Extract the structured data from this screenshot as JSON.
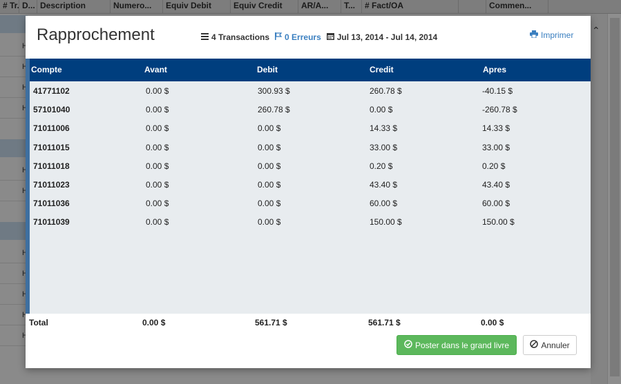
{
  "background": {
    "columns": [
      "# Tr...",
      "D...",
      "Description",
      "Numero...",
      "Equiv Debit",
      "Equiv Credit",
      "AR/A...",
      "T...",
      "# Fact/OA",
      "",
      "Commen..."
    ],
    "row_marker": "H"
  },
  "modal": {
    "title": "Rapprochement",
    "transactions": "4 Transactions",
    "errors": "0 Erreurs",
    "date_range": "Jul 13, 2014 - Jul 14, 2014",
    "print_label": "Imprimer"
  },
  "table": {
    "headers": [
      "Compte",
      "Avant",
      "Debit",
      "Credit",
      "Apres"
    ],
    "rows": [
      [
        "41771102",
        "0.00 $",
        "300.93 $",
        "260.78 $",
        "-40.15 $"
      ],
      [
        "57101040",
        "0.00 $",
        "260.78 $",
        "0.00 $",
        "-260.78 $"
      ],
      [
        "71011006",
        "0.00 $",
        "0.00 $",
        "14.33 $",
        "14.33 $"
      ],
      [
        "71011015",
        "0.00 $",
        "0.00 $",
        "33.00 $",
        "33.00 $"
      ],
      [
        "71011018",
        "0.00 $",
        "0.00 $",
        "0.20 $",
        "0.20 $"
      ],
      [
        "71011023",
        "0.00 $",
        "0.00 $",
        "43.40 $",
        "43.40 $"
      ],
      [
        "71011036",
        "0.00 $",
        "0.00 $",
        "60.00 $",
        "60.00 $"
      ],
      [
        "71011039",
        "0.00 $",
        "0.00 $",
        "150.00 $",
        "150.00 $"
      ]
    ],
    "total": [
      "Total",
      "0.00 $",
      "561.71 $",
      "561.71 $",
      "0.00 $"
    ]
  },
  "buttons": {
    "post": "Poster dans le grand livre",
    "cancel": "Annuler"
  },
  "colors": {
    "header_bg": "#003e7e",
    "link": "#3a7fc0",
    "success": "#5cb85c"
  }
}
